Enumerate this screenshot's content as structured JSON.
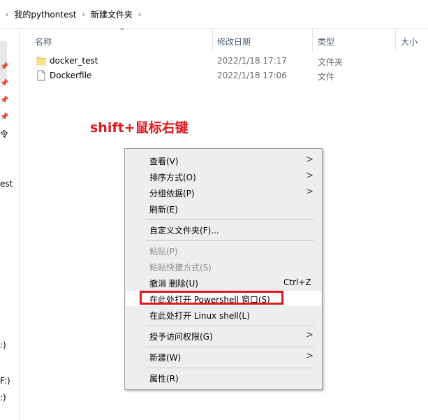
{
  "breadcrumb": {
    "items": [
      "我的pythontest",
      "新建文件夹"
    ]
  },
  "left_pane": {
    "fragments": [
      "令",
      "est",
      ":)",
      "F:)",
      ":)"
    ]
  },
  "columns": {
    "name": "名称",
    "modified": "修改日期",
    "type": "类型",
    "size": "大小"
  },
  "files": [
    {
      "name": "docker_test",
      "modified": "2022/1/18 17:17",
      "type": "文件夹",
      "icon": "folder-icon"
    },
    {
      "name": "Dockerfile",
      "modified": "2022/1/18 17:06",
      "type": "文件",
      "icon": "file-icon"
    }
  ],
  "annotation": "shift+鼠标右键",
  "context_menu": {
    "view": "查看(V)",
    "sort": "排序方式(O)",
    "group": "分组依据(P)",
    "refresh": "刷新(E)",
    "customize": "自定义文件夹(F)...",
    "paste": "粘贴(P)",
    "paste_shortcut": "粘贴快捷方式(S)",
    "undo_delete": "撤消 删除(U)",
    "undo_shortcut": "Ctrl+Z",
    "open_powershell": "在此处打开 Powershell 窗口(S)",
    "open_linux_shell": "在此处打开 Linux shell(L)",
    "give_access": "授予访问权限(G)",
    "new": "新建(W)",
    "properties": "属性(R)"
  },
  "colors": {
    "annotation_red": "#e0191f",
    "menu_bg": "#eeeeee",
    "folder_yellow": "#ffd767"
  }
}
